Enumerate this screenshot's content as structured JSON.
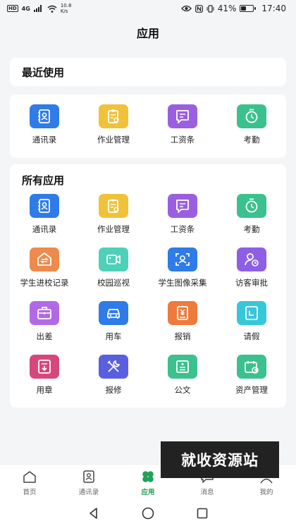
{
  "status_bar": {
    "hd": "HD",
    "network": "4G",
    "speed_value": "10.8",
    "speed_unit": "K/s",
    "battery": "41%",
    "battery_level": 0.41,
    "time": "17:40"
  },
  "header": {
    "title": "应用"
  },
  "recent": {
    "title": "最近使用",
    "apps": [
      {
        "label": "通讯录",
        "icon": "contacts-icon",
        "color": "#2f7be8"
      },
      {
        "label": "作业管理",
        "icon": "homework-icon",
        "color": "#f0c23a"
      },
      {
        "label": "工资条",
        "icon": "payslip-icon",
        "color": "#9a5fe0"
      },
      {
        "label": "考勤",
        "icon": "attendance-icon",
        "color": "#3bc18e"
      }
    ]
  },
  "all": {
    "title": "所有应用",
    "apps": [
      {
        "label": "通讯录",
        "icon": "contacts-icon",
        "color": "#2f7be8"
      },
      {
        "label": "作业管理",
        "icon": "homework-icon",
        "color": "#f0c23a"
      },
      {
        "label": "工资条",
        "icon": "payslip-icon",
        "color": "#9a5fe0"
      },
      {
        "label": "考勤",
        "icon": "attendance-icon",
        "color": "#3bc18e"
      },
      {
        "label": "学生进校记录",
        "icon": "school-entry-icon",
        "color": "#ee8a4c"
      },
      {
        "label": "校园巡视",
        "icon": "camera-icon",
        "color": "#4fd0b8"
      },
      {
        "label": "学生图像采集",
        "icon": "face-capture-icon",
        "color": "#2f7be8"
      },
      {
        "label": "访客审批",
        "icon": "visitor-icon",
        "color": "#8e5fe4"
      },
      {
        "label": "出差",
        "icon": "business-trip-icon",
        "color": "#b06ae6"
      },
      {
        "label": "用车",
        "icon": "car-icon",
        "color": "#2f7be8"
      },
      {
        "label": "报销",
        "icon": "reimburse-icon",
        "color": "#ee7a3c"
      },
      {
        "label": "请假",
        "icon": "leave-icon",
        "color": "#36c7d8"
      },
      {
        "label": "用章",
        "icon": "seal-icon",
        "color": "#d6477a"
      },
      {
        "label": "报修",
        "icon": "repair-icon",
        "color": "#5a5fe0"
      },
      {
        "label": "公文",
        "icon": "document-icon",
        "color": "#3bc18e"
      },
      {
        "label": "资产管理",
        "icon": "asset-icon",
        "color": "#3bc18e"
      }
    ]
  },
  "bottom_nav": [
    {
      "label": "首页",
      "icon": "home-icon"
    },
    {
      "label": "通讯录",
      "icon": "contacts-nav-icon"
    },
    {
      "label": "应用",
      "icon": "apps-icon",
      "active": true
    },
    {
      "label": "消息",
      "icon": "message-icon"
    },
    {
      "label": "我的",
      "icon": "profile-icon"
    }
  ],
  "watermark": "就收资源站",
  "colors": {
    "accent": "#21a05a",
    "background": "#f4f5f7"
  }
}
